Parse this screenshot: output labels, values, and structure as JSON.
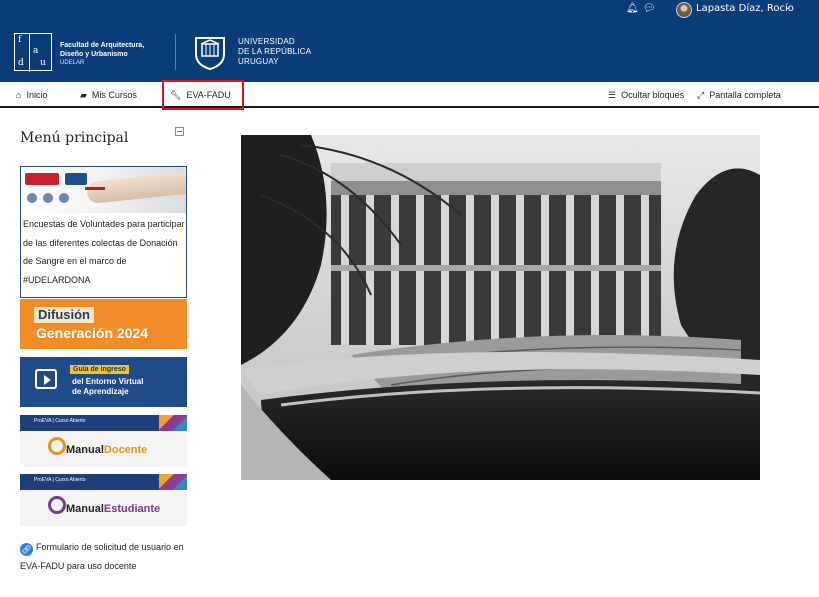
{
  "topbar": {
    "notification_icon": "bell-icon",
    "messages_icon": "chat-bubbles-icon",
    "user_name": "Lapasta Díaz, Rocío",
    "user_menu_icon": "chevron-down-icon"
  },
  "header": {
    "fadu_letters": [
      "f",
      "a",
      "d",
      "u"
    ],
    "fadu_name_line1": "Facultad de Arquitectura,",
    "fadu_name_line2": "Diseño y Urbanismo",
    "fadu_name_line3": "UDELAR",
    "udelar_line1": "UNIVERSIDAD",
    "udelar_line2": "DE LA REPÚBLICA",
    "udelar_line3": "URUGUAY"
  },
  "nav": {
    "inicio": "Inicio",
    "mis_cursos": "Mis Cursos",
    "eva_fadu": "EVA-FADU",
    "ocultar_bloques": "Ocultar bloques",
    "pantalla_completa": "Pantalla completa"
  },
  "sidebar": {
    "title": "Menú principal",
    "donacion_text": "Encuestas de Voluntades para participar de las diferentes colectas de Donación de Sangre en el marco de #UDELARDONA",
    "difusion_line1": "Difusión",
    "difusion_line2": "Generación 2024",
    "guia_line1": "Guía de ingreso",
    "guia_line2": "del Entorno Virtual",
    "guia_line3": "de Aprendizaje",
    "manual_docente_strip": "ProEVA | Curso Abierto",
    "manual_docente_a": "Manual",
    "manual_docente_b": "Docente",
    "manual_estudiante_strip": "ProEVA | Curso Abierto",
    "manual_estudiante_a": "Manual",
    "manual_estudiante_b": "Estudiante",
    "form_link": "Formulario de solicitud de usuario en EVA-FADU para uso docente"
  },
  "colors": {
    "brand_blue": "#0a3d78",
    "highlight_red": "#e0141e",
    "difusion_orange": "#f28c28",
    "guia_blue": "#1f4b8a"
  }
}
